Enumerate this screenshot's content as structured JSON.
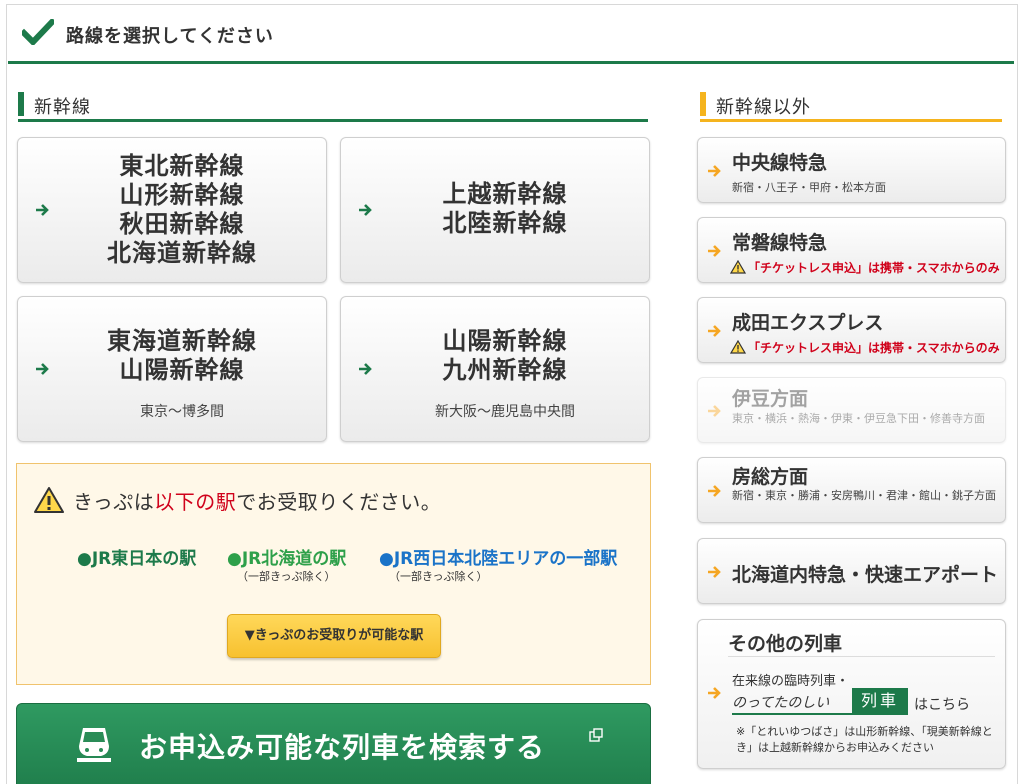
{
  "header": {
    "title": "路線を選択してください",
    "check_color": "#1d7a4a"
  },
  "shinkansen": {
    "heading": "新幹線",
    "buttons": [
      {
        "lines": [
          "東北新幹線",
          "山形新幹線",
          "秋田新幹線",
          "北海道新幹線"
        ],
        "sub": ""
      },
      {
        "lines": [
          "上越新幹線",
          "北陸新幹線"
        ],
        "sub": ""
      },
      {
        "lines": [
          "東海道新幹線",
          "山陽新幹線"
        ],
        "sub": "東京〜博多間"
      },
      {
        "lines": [
          "山陽新幹線",
          "九州新幹線"
        ],
        "sub": "新大阪〜鹿児島中央間"
      }
    ]
  },
  "notice": {
    "title_prefix": "きっぷは",
    "title_highlight": "以下の駅",
    "title_suffix": "でお受取りください。",
    "stations": [
      {
        "label": "●JR東日本の駅",
        "note": ""
      },
      {
        "label": "●JR北海道の駅",
        "note": "（一部きっぷ除く）"
      },
      {
        "label": "●JR西日本北陸エリアの一部駅",
        "note": "（一部きっぷ除く）"
      }
    ],
    "button_label": "▼きっぷのお受取りが可能な駅"
  },
  "search": {
    "label": "お申込み可能な列車を検索する"
  },
  "others": {
    "heading": "新幹線以外",
    "items": [
      {
        "title": "中央線特急",
        "desc": "新宿・八王子・甲府・松本方面",
        "warning": ""
      },
      {
        "title": "常磐線特急",
        "desc": "",
        "warning": "「チケットレス申込」は携帯・スマホからのみ"
      },
      {
        "title": "成田エクスプレス",
        "desc": "",
        "warning": "「チケットレス申込」は携帯・スマホからのみ"
      },
      {
        "title": "伊豆方面",
        "desc": "東京・横浜・熱海・伊東・伊豆急下田・修善寺方面",
        "warning": ""
      },
      {
        "title": "房総方面",
        "desc": "新宿・東京・勝浦・安房鴨川・君津・館山・銚子方面",
        "warning": ""
      },
      {
        "title": "北海道内特急・快速エアポート",
        "desc": "",
        "warning": ""
      }
    ],
    "other_trains": {
      "title": "その他の列車",
      "line1": "在来線の臨時列車・",
      "line2": "のってたのしい",
      "badge": "列車",
      "line3": "はこちら",
      "note": "※「とれいゆつばさ」は山形新幹線、「現美新幹線とき」は上越新幹線からお申込みください"
    }
  },
  "colors": {
    "green": "#1d7a4a",
    "orange": "#f5b41e",
    "red": "#d0021b",
    "blue": "#1a73c8"
  }
}
